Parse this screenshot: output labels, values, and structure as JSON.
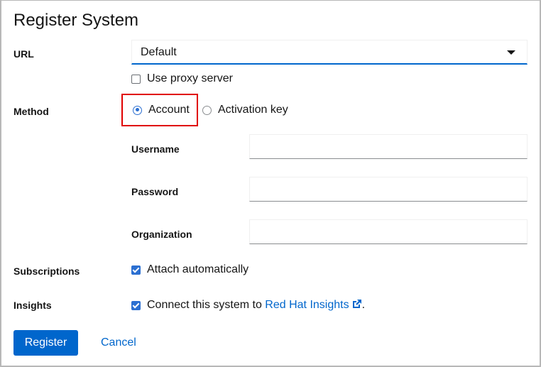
{
  "dialog": {
    "title": "Register System"
  },
  "url": {
    "label": "URL",
    "selected": "Default",
    "proxy_label": "Use proxy server",
    "proxy_checked": false
  },
  "method": {
    "label": "Method",
    "options": [
      {
        "label": "Account",
        "checked": true
      },
      {
        "label": "Activation key",
        "checked": false
      }
    ]
  },
  "fields": {
    "username": {
      "label": "Username",
      "value": ""
    },
    "password": {
      "label": "Password",
      "value": ""
    },
    "organization": {
      "label": "Organization",
      "value": ""
    }
  },
  "subscriptions": {
    "label": "Subscriptions",
    "option_label": "Attach automatically",
    "checked": true
  },
  "insights": {
    "label": "Insights",
    "prefix": "Connect this system to ",
    "link_text": "Red Hat Insights",
    "suffix": ".",
    "checked": true
  },
  "actions": {
    "register_label": "Register",
    "cancel_label": "Cancel"
  },
  "colors": {
    "accent": "#0066cc",
    "highlight": "#e00000"
  }
}
